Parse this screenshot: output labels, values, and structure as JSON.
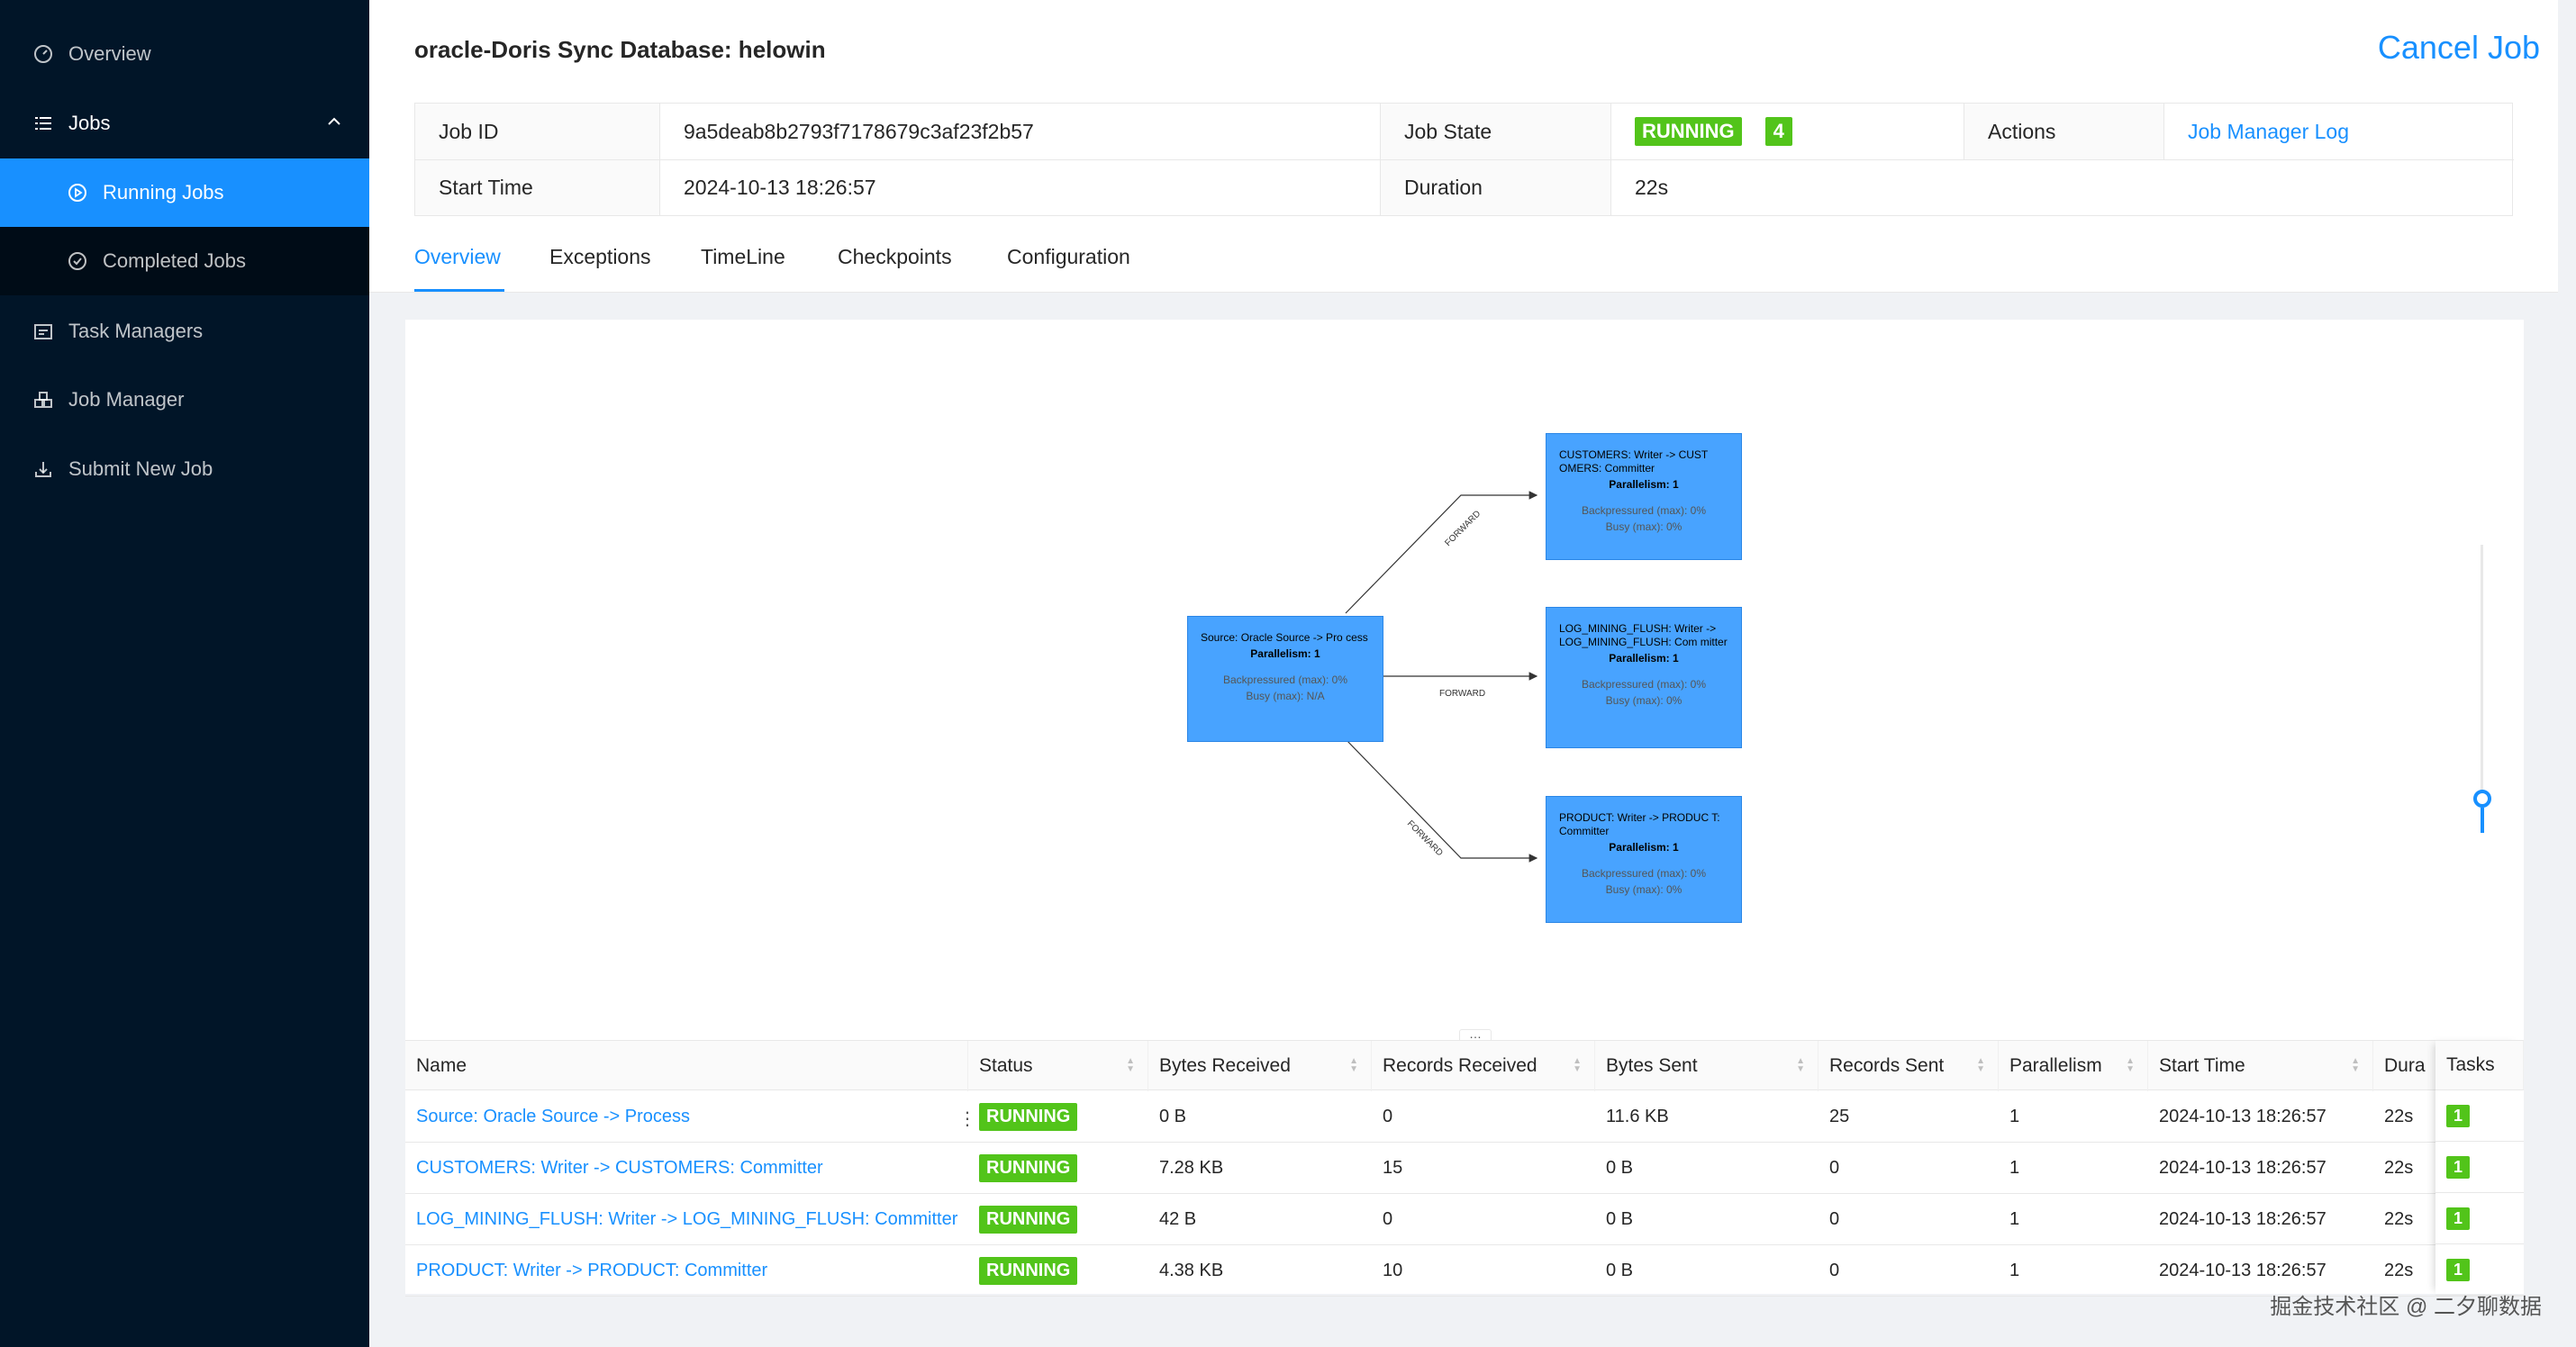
{
  "sidebar": {
    "items": [
      {
        "label": "Overview",
        "icon": "dashboard-icon"
      },
      {
        "label": "Jobs",
        "icon": "list-icon"
      },
      {
        "label": "Running Jobs",
        "icon": "play-circle-icon"
      },
      {
        "label": "Completed Jobs",
        "icon": "check-circle-icon"
      },
      {
        "label": "Task Managers",
        "icon": "schedule-icon"
      },
      {
        "label": "Job Manager",
        "icon": "cluster-icon"
      },
      {
        "label": "Submit New Job",
        "icon": "upload-icon"
      }
    ]
  },
  "job": {
    "title": "oracle-Doris Sync Database: helowin",
    "cancel_label": "Cancel Job",
    "fields": {
      "job_id_label": "Job ID",
      "job_id_value": "9a5deab8b2793f7178679c3af23f2b57",
      "job_state_label": "Job State",
      "job_state_value": "RUNNING",
      "job_state_count": "4",
      "actions_label": "Actions",
      "actions_value": "Job Manager Log",
      "start_time_label": "Start Time",
      "start_time_value": "2024-10-13 18:26:57",
      "duration_label": "Duration",
      "duration_value": "22s"
    }
  },
  "tabs": [
    "Overview",
    "Exceptions",
    "TimeLine",
    "Checkpoints",
    "Configuration"
  ],
  "graph": {
    "nodes": [
      {
        "title": "Source: Oracle Source -> Pro cess",
        "parallelism": "Parallelism: 1",
        "backpressure": "Backpressured (max): 0%",
        "busy": "Busy (max): N/A"
      },
      {
        "title": "CUSTOMERS: Writer -> CUST OMERS: Committer",
        "parallelism": "Parallelism: 1",
        "backpressure": "Backpressured (max): 0%",
        "busy": "Busy (max): 0%"
      },
      {
        "title": "LOG_MINING_FLUSH: Writer -> LOG_MINING_FLUSH: Com mitter",
        "parallelism": "Parallelism: 1",
        "backpressure": "Backpressured (max): 0%",
        "busy": "Busy (max): 0%"
      },
      {
        "title": "PRODUCT: Writer -> PRODUC T: Committer",
        "parallelism": "Parallelism: 1",
        "backpressure": "Backpressured (max): 0%",
        "busy": "Busy (max): 0%"
      }
    ],
    "edge_label": "FORWARD"
  },
  "table": {
    "columns": [
      "Name",
      "Status",
      "Bytes Received",
      "Records Received",
      "Bytes Sent",
      "Records Sent",
      "Parallelism",
      "Start Time",
      "Dura",
      "Tasks"
    ],
    "rows": [
      {
        "name": "Source: Oracle Source -> Process",
        "status": "RUNNING",
        "bytes_received": "0 B",
        "records_received": "0",
        "bytes_sent": "11.6 KB",
        "records_sent": "25",
        "parallelism": "1",
        "start_time": "2024-10-13 18:26:57",
        "duration": "22s",
        "tasks": "1"
      },
      {
        "name": "CUSTOMERS: Writer -> CUSTOMERS: Committer",
        "status": "RUNNING",
        "bytes_received": "7.28 KB",
        "records_received": "15",
        "bytes_sent": "0 B",
        "records_sent": "0",
        "parallelism": "1",
        "start_time": "2024-10-13 18:26:57",
        "duration": "22s",
        "tasks": "1"
      },
      {
        "name": "LOG_MINING_FLUSH: Writer -> LOG_MINING_FLUSH: Committer",
        "status": "RUNNING",
        "bytes_received": "42 B",
        "records_received": "0",
        "bytes_sent": "0 B",
        "records_sent": "0",
        "parallelism": "1",
        "start_time": "2024-10-13 18:26:57",
        "duration": "22s",
        "tasks": "1"
      },
      {
        "name": "PRODUCT: Writer -> PRODUCT: Committer",
        "status": "RUNNING",
        "bytes_received": "4.38 KB",
        "records_received": "10",
        "bytes_sent": "0 B",
        "records_sent": "0",
        "parallelism": "1",
        "start_time": "2024-10-13 18:26:57",
        "duration": "22s",
        "tasks": "1"
      }
    ]
  },
  "watermark": "掘金技术社区 @ 二夕聊数据",
  "colors": {
    "accent": "#1890ff",
    "sidebar": "#011528",
    "running": "#52c41a",
    "node": "#48a3ff"
  }
}
